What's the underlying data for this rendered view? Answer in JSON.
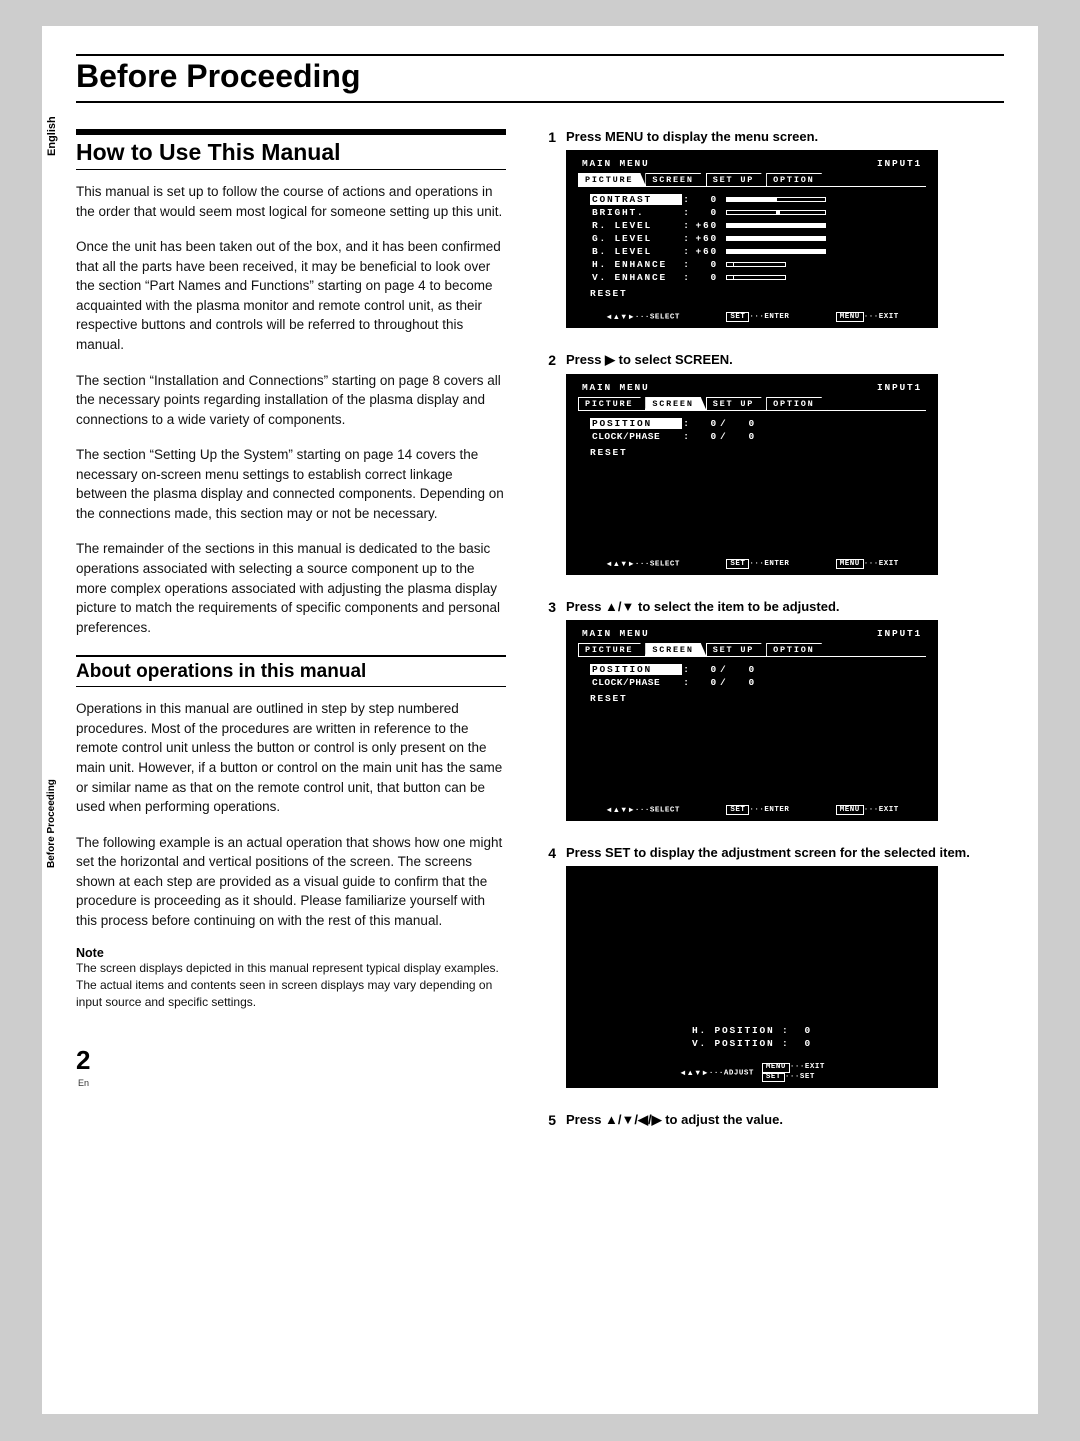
{
  "side": {
    "language": "English",
    "section": "Before Proceeding"
  },
  "title": "Before Proceeding",
  "heading1": "How to Use This Manual",
  "heading2": "About operations in this manual",
  "paras": {
    "p1": "This manual is set up to follow the course of actions and operations in the order that would seem most logical for someone setting up this unit.",
    "p2": "Once the unit has been taken out of the box, and it has been confirmed that all the parts have been received, it may be beneficial to look over the section “Part Names and Functions” starting on page 4 to become acquainted with the plasma monitor and remote control unit, as their respective buttons and controls will be referred to throughout this manual.",
    "p3": "The section “Installation and Connections” starting on page 8 covers all the necessary points regarding installation of the plasma display and connections to a wide variety of components.",
    "p4": "The section “Setting Up the System” starting on page 14 covers the necessary on-screen menu settings to establish correct linkage between the plasma display and connected components. Depending on the connections made, this section may or not be necessary.",
    "p5": "The remainder of the sections in this manual is dedicated to the basic operations associated with selecting a source component up to the more complex operations associated with adjusting the plasma display picture to match the requirements of specific components and personal preferences.",
    "p6": "Operations in this manual are outlined in step by step numbered procedures. Most of the procedures are written in reference to the remote control unit unless the button or control is only present on the main unit. However, if a button or control on the main unit has the same or similar name as that on the remote control unit, that button can be used when performing operations.",
    "p7": "The following example is an actual operation that shows how one might set the horizontal and vertical positions of the screen. The screens shown at each step are provided as a visual guide to confirm that the procedure is proceeding as it should.  Please familiarize yourself with this process before continuing on with the rest of this manual."
  },
  "note": {
    "head": "Note",
    "l1": "The screen displays depicted in this manual represent typical display examples.",
    "l2": "The actual items and contents seen in screen displays may vary depending on input source and specific settings."
  },
  "page": {
    "num": "2",
    "lang": "En"
  },
  "steps": {
    "s1": "Press MENU to display the menu screen.",
    "s2": "Press ▶ to select SCREEN.",
    "s3": "Press ▲/▼ to select the item to be adjusted.",
    "s4": "Press SET to display the adjustment screen for the selected item.",
    "s5": "Press ▲/▼/◀/▶ to adjust the value."
  },
  "osd": {
    "main_menu": "MAIN MENU",
    "input": "INPUT1",
    "tabs": {
      "picture": "PICTURE",
      "screen": "SCREEN",
      "setup": "SET UP",
      "option": "OPTION"
    },
    "picture_items": [
      {
        "label": "CONTRAST",
        "val": "0"
      },
      {
        "label": "BRIGHT.",
        "val": "0"
      },
      {
        "label": "R. LEVEL",
        "val": "+60"
      },
      {
        "label": "G. LEVEL",
        "val": "+60"
      },
      {
        "label": "B. LEVEL",
        "val": "+60"
      },
      {
        "label": "H. ENHANCE",
        "val": "0"
      },
      {
        "label": "V. ENHANCE",
        "val": "0"
      }
    ],
    "reset": "RESET",
    "screen_items": {
      "position": {
        "label": "POSITION",
        "v1": "0",
        "v2": "0"
      },
      "clockphase": {
        "label": "CLOCK/PHASE",
        "v1": "0",
        "v2": "0"
      }
    },
    "adjust_screen": {
      "hpos": {
        "label": "H. POSITION",
        "val": "0"
      },
      "vpos": {
        "label": "V. POSITION",
        "val": "0"
      }
    },
    "footer": {
      "select": "SELECT",
      "set": "SET",
      "enter": "ENTER",
      "menu": "MENU",
      "exit": "EXIT",
      "adjust": "ADJUST",
      "set2": "SET"
    }
  }
}
